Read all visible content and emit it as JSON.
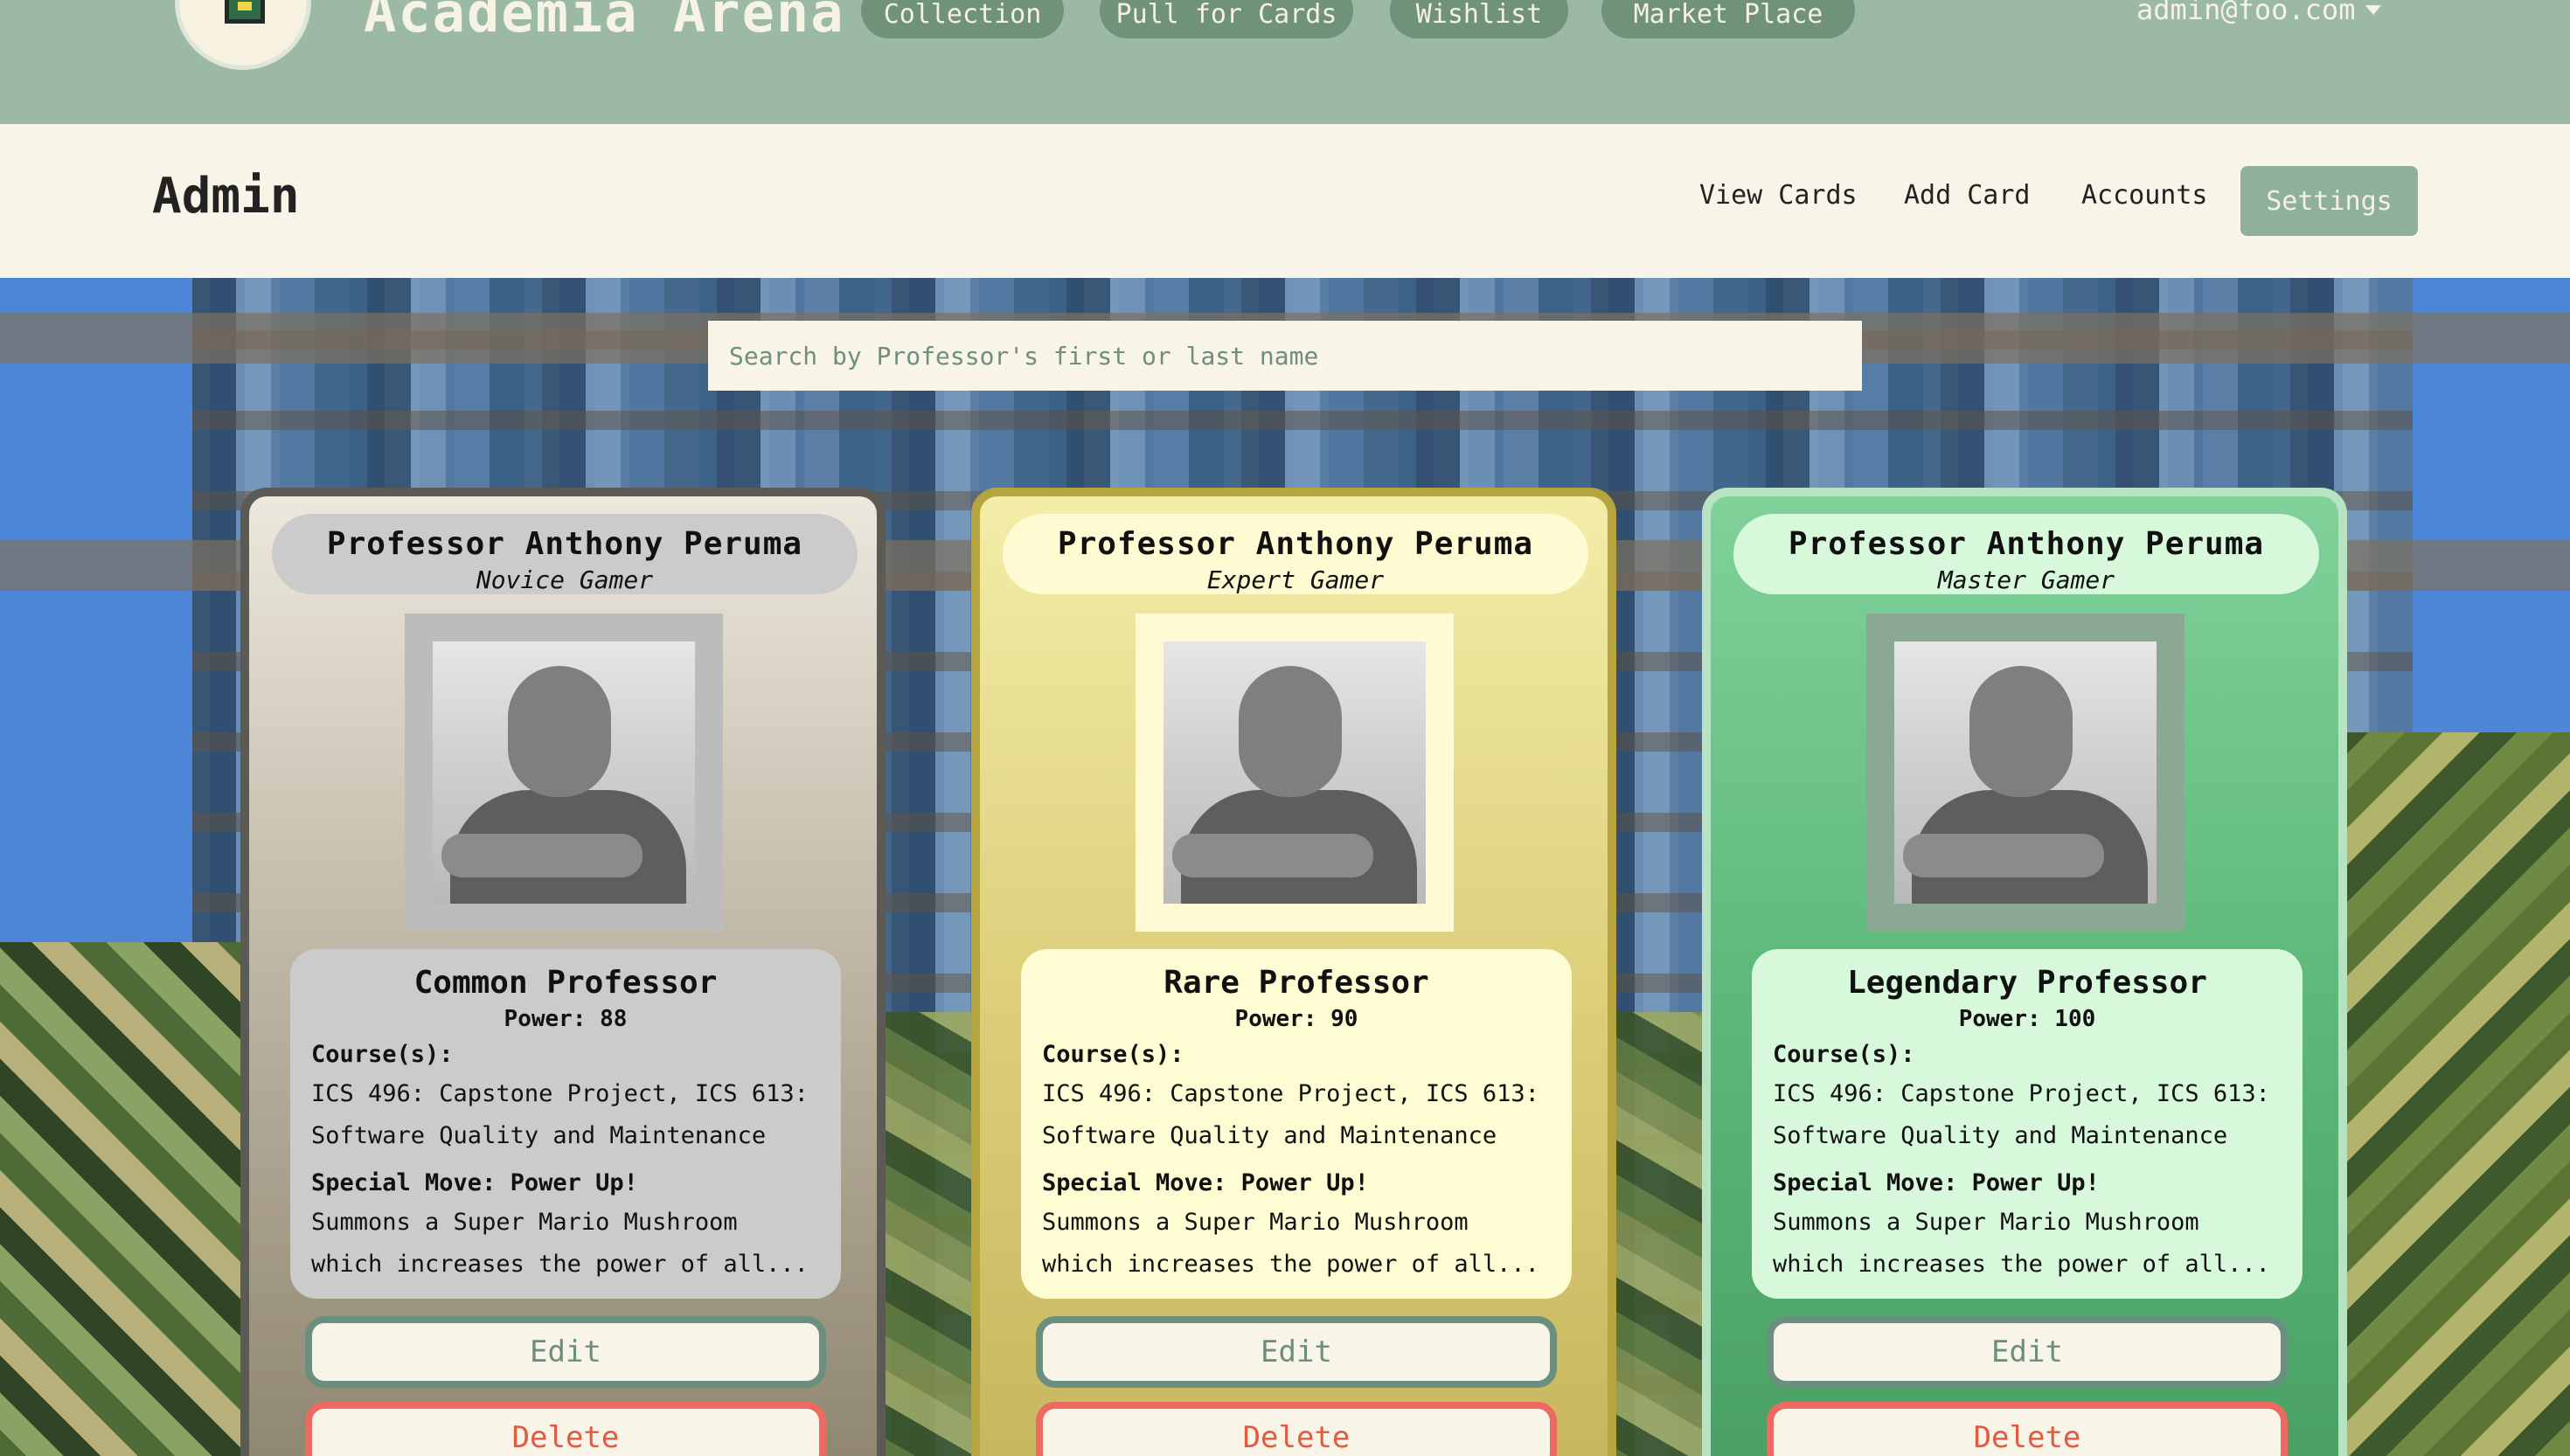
{
  "nav": {
    "brand": "Academia Arena",
    "links": [
      "Collection",
      "Pull for Cards",
      "Wishlist",
      "Market Place"
    ],
    "user": "admin@foo.com"
  },
  "admin": {
    "title": "Admin",
    "links": [
      "View Cards",
      "Add Card",
      "Accounts"
    ],
    "settings": "Settings"
  },
  "search": {
    "placeholder": "Search by Professor's first or last name"
  },
  "cards": [
    {
      "name": "Professor Anthony Peruma",
      "title": "Novice Gamer",
      "rarity": "Common Professor",
      "power": "Power: 88",
      "courses_label": "Course(s):",
      "courses": "ICS 496: Capstone Project, ICS 613: Software Quality and Maintenance",
      "special_label": "Special Move:",
      "special": "Power Up!",
      "description": "Summons a Super Mario Mushroom which increases the power of all...",
      "edit": "Edit",
      "delete": "Delete"
    },
    {
      "name": "Professor Anthony Peruma",
      "title": "Expert Gamer",
      "rarity": "Rare Professor",
      "power": "Power: 90",
      "courses_label": "Course(s):",
      "courses": "ICS 496: Capstone Project, ICS 613: Software Quality and Maintenance",
      "special_label": "Special Move:",
      "special": "Power Up!",
      "description": "Summons a Super Mario Mushroom which increases the power of all...",
      "edit": "Edit",
      "delete": "Delete"
    },
    {
      "name": "Professor Anthony Peruma",
      "title": "Master Gamer",
      "rarity": "Legendary Professor",
      "power": "Power: 100",
      "courses_label": "Course(s):",
      "courses": "ICS 496: Capstone Project, ICS 613: Software Quality and Maintenance",
      "special_label": "Special Move:",
      "special": "Power Up!",
      "description": "Summons a Super Mario Mushroom which increases the power of all...",
      "edit": "Edit",
      "delete": "Delete"
    }
  ],
  "colors": {
    "nav_bg": "#9bb9a5",
    "cream": "#f8f4e7",
    "accent_green": "#6b8f7e",
    "delete_red": "#ec6a62"
  }
}
